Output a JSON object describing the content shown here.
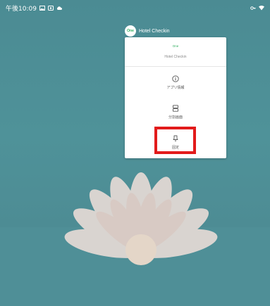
{
  "status_bar": {
    "time": "午後10:09",
    "left_icons": [
      "image-icon",
      "cast-icon",
      "cloud-icon"
    ],
    "right_icons": [
      "key-icon",
      "wifi-icon"
    ]
  },
  "app_header": {
    "icon_text": "One",
    "name": "Hotel Checkin"
  },
  "menu": {
    "brand_label": "One",
    "title": "Hotel Checkin",
    "items": [
      {
        "label": "アプリ情報",
        "icon": "info-icon"
      },
      {
        "label": "分割画面",
        "icon": "split-screen-icon"
      },
      {
        "label": "固定",
        "icon": "pin-icon"
      }
    ]
  },
  "colors": {
    "wallpaper": "#4f8f97",
    "accent": "#2fae5e",
    "highlight": "#e21b1b"
  }
}
